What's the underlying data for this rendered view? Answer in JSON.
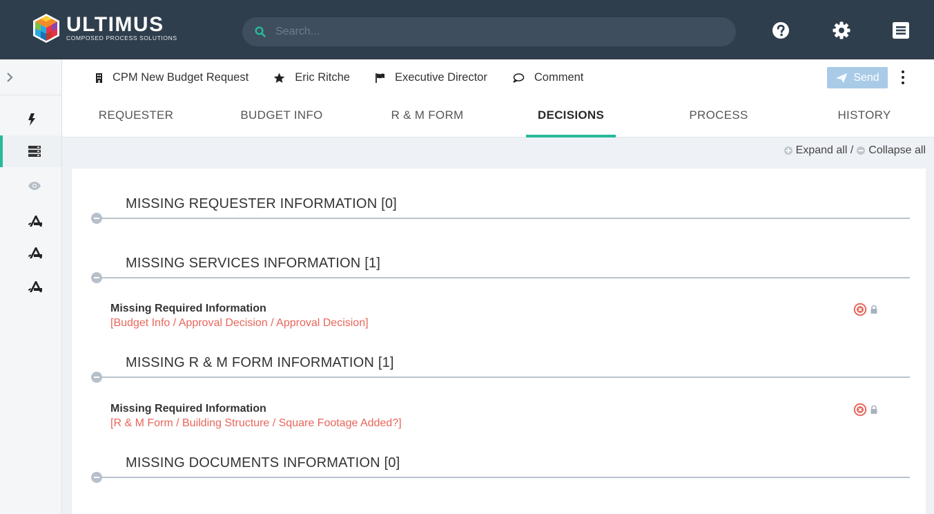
{
  "app": {
    "logo_name": "ULTIMUS",
    "logo_tagline": "COMPOSED PROCESS SOLUTIONS"
  },
  "search": {
    "placeholder": "Search..."
  },
  "icons": {
    "help": "help-icon",
    "settings": "gear-icon",
    "menu": "menu-icon",
    "expand": "chevron-right-icon",
    "rail": [
      "bolt-icon",
      "server-icon",
      "eye-icon",
      "drafting-icon",
      "drafting-icon",
      "drafting-icon"
    ]
  },
  "header": {
    "crumbs": [
      {
        "icon": "building-icon",
        "label": "CPM New Budget Request"
      },
      {
        "icon": "star-icon",
        "label": "Eric Ritche"
      },
      {
        "icon": "flag-icon",
        "label": "Executive Director"
      },
      {
        "icon": "comment-icon",
        "label": "Comment"
      }
    ],
    "send_label": "Send"
  },
  "tabs": [
    {
      "label": "REQUESTER",
      "active": false
    },
    {
      "label": "BUDGET INFO",
      "active": false
    },
    {
      "label": "R & M FORM",
      "active": false
    },
    {
      "label": "DECISIONS",
      "active": true
    },
    {
      "label": "PROCESS",
      "active": false
    },
    {
      "label": "HISTORY",
      "active": false
    }
  ],
  "toolbar": {
    "expand_label": "Expand all /",
    "collapse_label": "Collapse all"
  },
  "sections": [
    {
      "title": "MISSING REQUESTER INFORMATION [0]",
      "issues": []
    },
    {
      "title": "MISSING SERVICES INFORMATION [1]",
      "issues": [
        {
          "title": "Missing Required Information",
          "path": "[Budget Info / Approval Decision / Approval Decision]"
        }
      ]
    },
    {
      "title": "MISSING R & M FORM INFORMATION [1]",
      "issues": [
        {
          "title": "Missing Required Information",
          "path": "[R & M Form / Building Structure / Square Footage Added?]"
        }
      ]
    },
    {
      "title": "MISSING DOCUMENTS INFORMATION [0]",
      "issues": []
    }
  ],
  "colors": {
    "topbar": "#2f3e4c",
    "accent": "#26b99a",
    "error": "#e8655a",
    "send": "#a9cbe8"
  }
}
